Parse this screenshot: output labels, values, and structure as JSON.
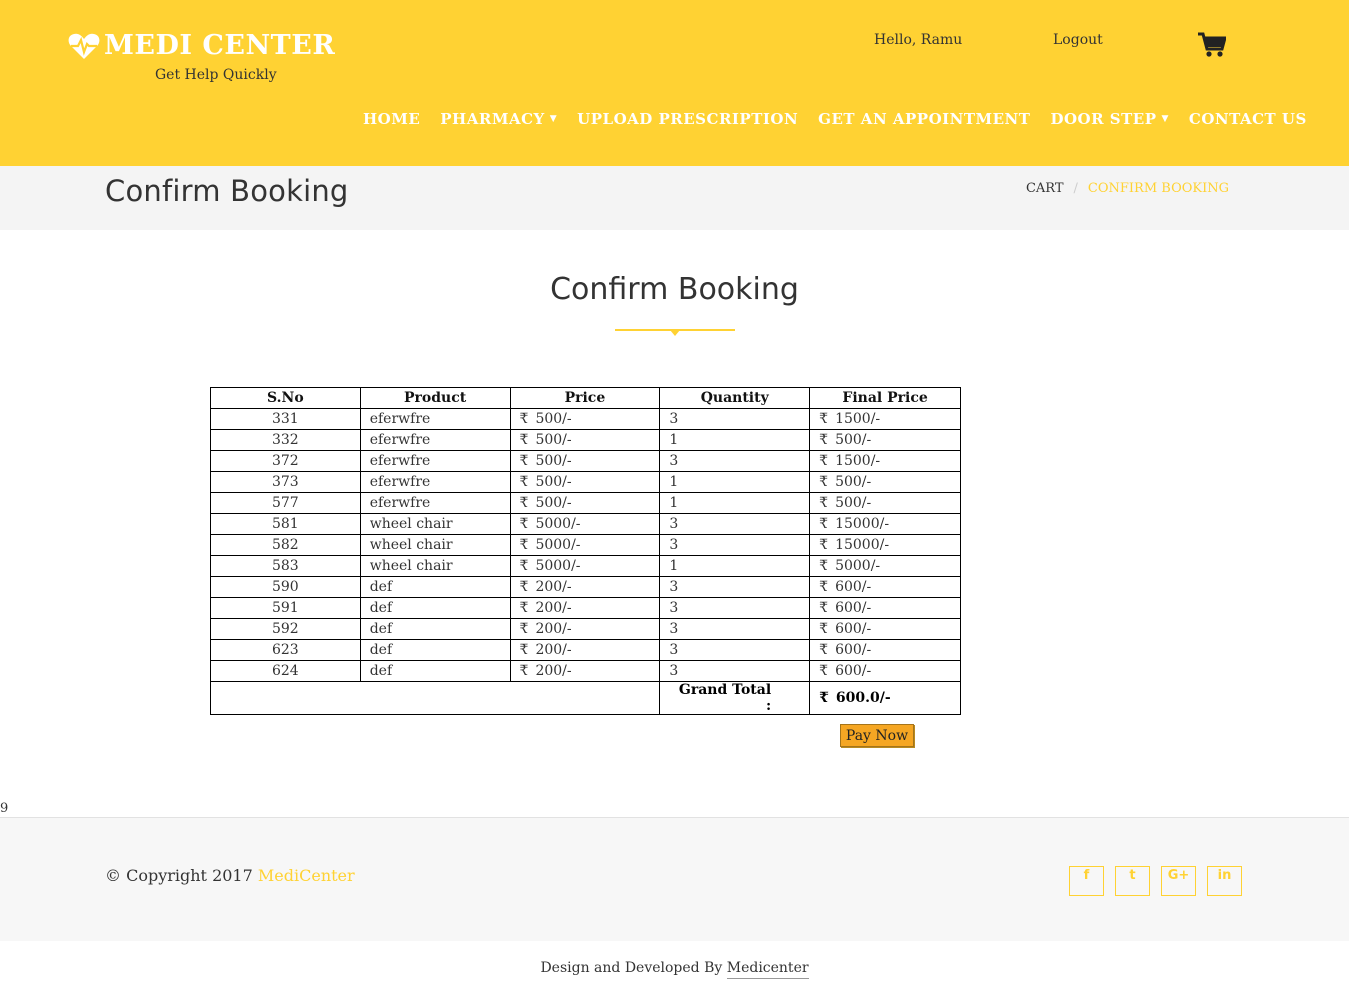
{
  "header": {
    "brand": "MEDI CENTER",
    "tagline": "Get Help Quickly",
    "greeting": "Hello, Ramu",
    "logout": "Logout",
    "cart_icon": "shopping-cart-icon",
    "bg_color": "#ffd233"
  },
  "nav": {
    "home": "HOME",
    "pharmacy": "PHARMACY",
    "upload": "UPLOAD PRESCRIPTION",
    "appointment": "GET AN APPOINTMENT",
    "doorstep": "DOOR STEP",
    "contact": "CONTACT US"
  },
  "titlebar": {
    "title": "Confirm Booking",
    "crumb_cart": "CART",
    "crumb_sep": "/",
    "crumb_current": "CONFIRM BOOKING"
  },
  "section": {
    "title": "Confirm Booking"
  },
  "table": {
    "headers": [
      "S.No",
      "Product",
      "Price",
      "Quantity",
      "Final Price"
    ],
    "currency": "₹",
    "rows": [
      {
        "sno": "331",
        "product": "eferwfre",
        "price": "500/-",
        "qty": "3",
        "final": "1500/-"
      },
      {
        "sno": "332",
        "product": "eferwfre",
        "price": "500/-",
        "qty": "1",
        "final": "500/-"
      },
      {
        "sno": "372",
        "product": "eferwfre",
        "price": "500/-",
        "qty": "3",
        "final": "1500/-"
      },
      {
        "sno": "373",
        "product": "eferwfre",
        "price": "500/-",
        "qty": "1",
        "final": "500/-"
      },
      {
        "sno": "577",
        "product": "eferwfre",
        "price": "500/-",
        "qty": "1",
        "final": "500/-"
      },
      {
        "sno": "581",
        "product": "wheel chair",
        "price": "5000/-",
        "qty": "3",
        "final": "15000/-"
      },
      {
        "sno": "582",
        "product": "wheel chair",
        "price": "5000/-",
        "qty": "3",
        "final": "15000/-"
      },
      {
        "sno": "583",
        "product": "wheel chair",
        "price": "5000/-",
        "qty": "1",
        "final": "5000/-"
      },
      {
        "sno": "590",
        "product": "def",
        "price": "200/-",
        "qty": "3",
        "final": "600/-"
      },
      {
        "sno": "591",
        "product": "def",
        "price": "200/-",
        "qty": "3",
        "final": "600/-"
      },
      {
        "sno": "592",
        "product": "def",
        "price": "200/-",
        "qty": "3",
        "final": "600/-"
      },
      {
        "sno": "623",
        "product": "def",
        "price": "200/-",
        "qty": "3",
        "final": "600/-"
      },
      {
        "sno": "624",
        "product": "def",
        "price": "200/-",
        "qty": "3",
        "final": "600/-"
      }
    ],
    "grand_label": "Grand Total :",
    "grand_value": "600.0/-"
  },
  "pay_button": "Pay Now",
  "stray_text": "9",
  "footer": {
    "copyright": "© Copyright 2017",
    "brand": "MediCenter",
    "social": [
      "facebook-icon",
      "twitter-icon",
      "google-plus-icon",
      "linkedin-icon"
    ],
    "social_glyphs": [
      "f",
      "t",
      "G+",
      "in"
    ]
  },
  "credits": {
    "prefix": "Design and Developed By",
    "developer": "Medicenter"
  }
}
